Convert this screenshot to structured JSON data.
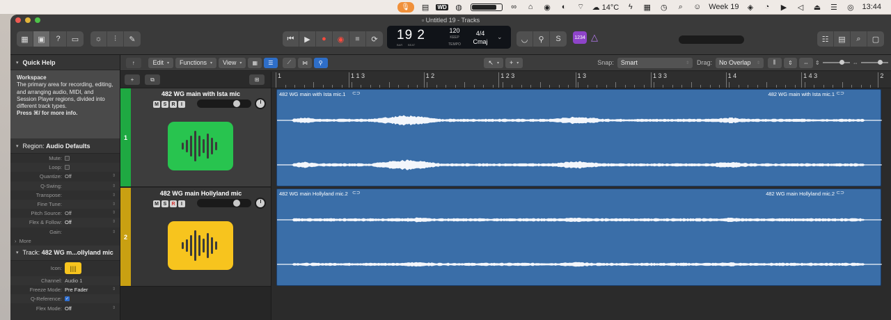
{
  "menubar": {
    "temperature": "14°C",
    "week": "Week 19",
    "time": "13:44",
    "battery_level": 0.85
  },
  "window": {
    "title": "Untitled 19 - Tracks"
  },
  "lcd": {
    "bar": "19",
    "beat": "2",
    "bar_label": "BAR",
    "beat_label": "BEAT",
    "tempo": "120",
    "keep": "KEEP",
    "tempo_label": "TEMPO",
    "time_signature": "4/4",
    "key": "Cmaj"
  },
  "badge": {
    "count": "1234"
  },
  "quick_help": {
    "title": "Quick Help",
    "heading": "Workspace",
    "body": "The primary area for recording, editing, and arranging audio, MIDI, and Session Player regions, divided into different track types.",
    "hint": "Press ⌘/ for more info."
  },
  "region_inspector": {
    "label": "Region:",
    "value": "Audio Defaults",
    "props": [
      {
        "k": "Mute:",
        "type": "check",
        "checked": false
      },
      {
        "k": "Loop:",
        "type": "check",
        "checked": false
      },
      {
        "k": "Quantize:",
        "v": "Off"
      },
      {
        "k": "Q-Swing:",
        "v": ""
      },
      {
        "k": "Transpose:",
        "v": ""
      },
      {
        "k": "Fine Tune:",
        "v": ""
      },
      {
        "k": "Pitch Source:",
        "v": "Off"
      },
      {
        "k": "Flex & Follow:",
        "v": "Off"
      },
      {
        "k": "Gain:",
        "v": ""
      }
    ],
    "more": "More"
  },
  "track_inspector": {
    "label": "Track:",
    "value": "482 WG m...ollyland mic",
    "icon_label": "Icon:",
    "channel_label": "Channel:",
    "channel": "Audio 1",
    "freeze_label": "Freeze Mode:",
    "freeze": "Pre Fader",
    "qref_label": "Q-Reference:",
    "flex_label": "Flex Mode:",
    "flex": "Off"
  },
  "toolbar": {
    "edit": "Edit",
    "functions": "Functions",
    "view": "View",
    "snap_label": "Snap:",
    "snap": "Smart",
    "drag_label": "Drag:",
    "drag": "No Overlap"
  },
  "ruler": {
    "labels": [
      {
        "text": "1",
        "pos": 0.0
      },
      {
        "text": "1 1 3",
        "pos": 0.121
      },
      {
        "text": "1 2",
        "pos": 0.245
      },
      {
        "text": "1 2 3",
        "pos": 0.369
      },
      {
        "text": "1 3",
        "pos": 0.496
      },
      {
        "text": "1 3 3",
        "pos": 0.621
      },
      {
        "text": "1 4",
        "pos": 0.745
      },
      {
        "text": "1 4 3",
        "pos": 0.87
      },
      {
        "text": "2",
        "pos": 0.997
      }
    ]
  },
  "tracks": [
    {
      "number": "1",
      "name": "482 WG main with Ista mic",
      "region_name": "482 WG main with Ista mic.1",
      "color": "#28c44f",
      "num_color": "#1fa942"
    },
    {
      "number": "2",
      "name": "482 WG main Hollyland mic",
      "region_name": "482 WG main Hollyland mic.2",
      "color": "#f7c41e",
      "num_color": "#c9a012"
    }
  ],
  "colors": {
    "region": "#3a6ea8",
    "accent_blue": "#2e6ec8"
  }
}
